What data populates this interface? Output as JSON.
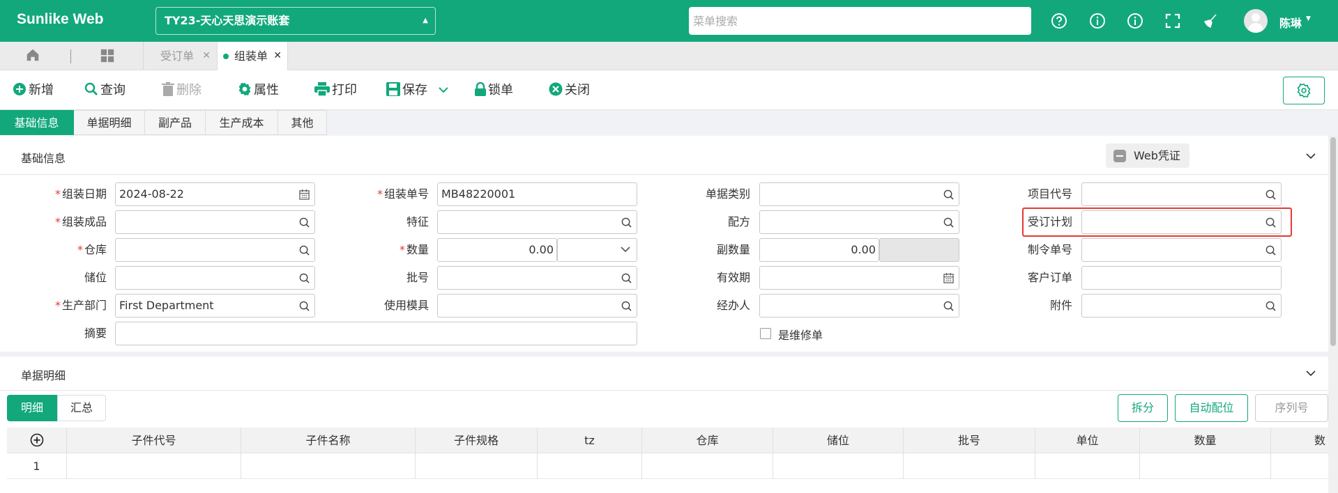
{
  "brand": "Sunlike Web",
  "account": {
    "name": "TY23-天心天思演示账套"
  },
  "search": {
    "placeholder": "菜单搜索"
  },
  "user": {
    "name": "陈琳"
  },
  "tabs": [
    {
      "label": "受订单",
      "active": false
    },
    {
      "label": "组装单",
      "active": true
    }
  ],
  "toolbar": {
    "new": "新增",
    "query": "查询",
    "delete": "删除",
    "properties": "属性",
    "print": "打印",
    "save": "保存",
    "lock": "锁单",
    "close": "关闭"
  },
  "section_tabs": [
    "基础信息",
    "单据明细",
    "副产品",
    "生产成本",
    "其他"
  ],
  "basic": {
    "title": "基础信息",
    "web_voucher": "Web凭证",
    "labels": {
      "assembly_date": "组装日期",
      "assembly_no": "组装单号",
      "doc_category": "单据类别",
      "project_code": "项目代号",
      "assembly_product": "组装成品",
      "feature": "特征",
      "formula": "配方",
      "sales_plan": "受订计划",
      "warehouse": "仓库",
      "quantity": "数量",
      "sub_quantity": "副数量",
      "work_order_no": "制令单号",
      "location": "储位",
      "batch_no": "批号",
      "expiry": "有效期",
      "customer_order": "客户订单",
      "dept": "生产部门",
      "mold": "使用模具",
      "handler": "经办人",
      "attachment": "附件",
      "summary": "摘要",
      "is_repair": "是维修单"
    },
    "values": {
      "assembly_date": "2024-08-22",
      "assembly_no": "MB48220001",
      "quantity": "0.00",
      "sub_quantity": "0.00",
      "dept": "First Department"
    }
  },
  "detail": {
    "title": "单据明细",
    "subtabs": [
      "明细",
      "汇总"
    ],
    "buttons": {
      "split": "拆分",
      "auto_allocate": "自动配位",
      "serial": "序列号"
    },
    "columns": [
      "子件代号",
      "子件名称",
      "子件规格",
      "tz",
      "仓库",
      "储位",
      "批号",
      "单位",
      "数量",
      "数"
    ],
    "rows": [
      {
        "index": "1"
      }
    ]
  },
  "colors": {
    "primary": "#12a87c",
    "required": "#e53935",
    "highlight": "#e53935"
  }
}
